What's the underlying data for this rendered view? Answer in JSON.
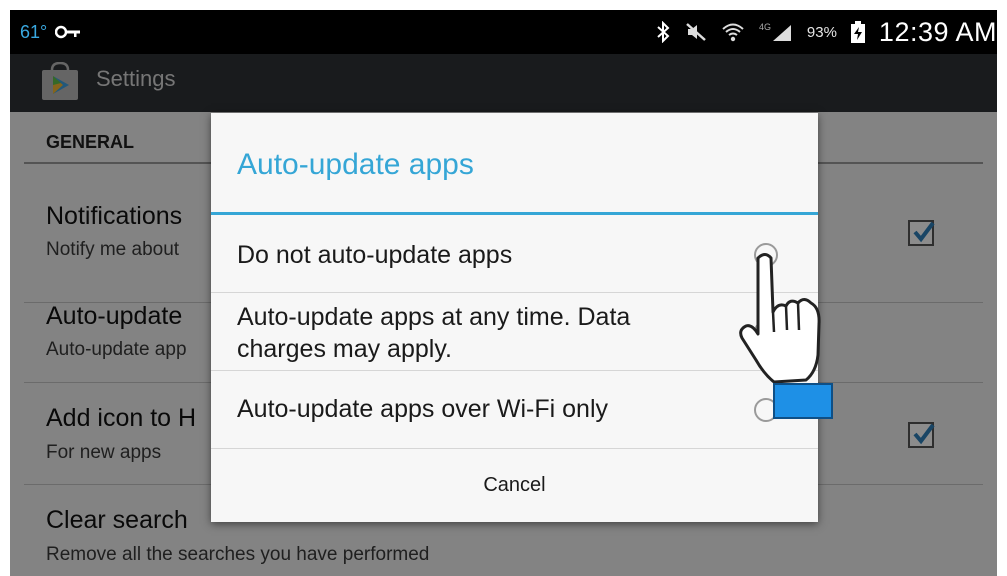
{
  "statusbar": {
    "temperature": "61°",
    "battery_percent": "93%",
    "time": "12:39 AM",
    "network": "4G"
  },
  "actionbar": {
    "title": "Settings",
    "icon": "play-store-icon"
  },
  "settings": {
    "section": "GENERAL",
    "rows": [
      {
        "title": "Notifications",
        "subtitle": "Notify me about",
        "checked": true
      },
      {
        "title": "Auto-update",
        "subtitle": "Auto-update app",
        "checked": null
      },
      {
        "title": "Add icon to H",
        "subtitle": "For new apps",
        "checked": true
      },
      {
        "title": "Clear search",
        "subtitle": "Remove all the searches you have performed",
        "checked": null
      }
    ]
  },
  "dialog": {
    "title": "Auto-update apps",
    "options": [
      {
        "label": "Do not auto-update apps",
        "selected": false
      },
      {
        "label_line1": "Auto-update apps at any time. Data",
        "label_line2": "charges may apply.",
        "selected": false
      },
      {
        "label": "Auto-update apps over Wi-Fi only",
        "selected": false
      }
    ],
    "cancel_label": "Cancel"
  },
  "colors": {
    "accent": "#35a6d6",
    "statusbar_bg": "#000000",
    "actionbar_bg": "#2f3235",
    "checkbox_check": "#2e7fb8",
    "cursor_cuff": "#1e90e6"
  }
}
